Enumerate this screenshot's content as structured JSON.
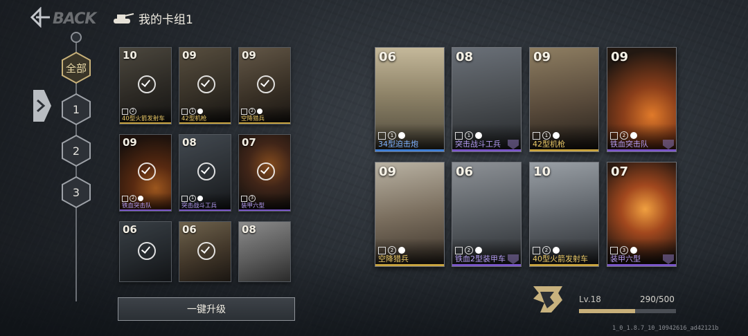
{
  "header": {
    "back_label": "BACK",
    "deck_title": "我的卡组1"
  },
  "deck_tabs": [
    {
      "label": "全部",
      "active": true
    },
    {
      "label": "1",
      "active": false
    },
    {
      "label": "2",
      "active": false
    },
    {
      "label": "3",
      "active": false
    }
  ],
  "deck_cards": [
    {
      "cost": "10",
      "name": "40型火箭发射车",
      "rarity": "gold",
      "stat_icon": "rocket-icon",
      "stat_value": "2",
      "selected": true,
      "flag": false
    },
    {
      "cost": "09",
      "name": "42型机枪",
      "rarity": "gold",
      "stat_icon": "mg-icon",
      "stat_value": "1",
      "selected": true,
      "flag": true
    },
    {
      "cost": "09",
      "name": "空降猎兵",
      "rarity": "gold",
      "stat_icon": "para-icon",
      "stat_value": "2",
      "selected": true,
      "flag": true
    },
    {
      "cost": "09",
      "name": "铁血突击队",
      "rarity": "purple",
      "stat_icon": "assault-icon",
      "stat_value": "2",
      "selected": true,
      "flag": true
    },
    {
      "cost": "08",
      "name": "突击战斗工兵",
      "rarity": "purple",
      "stat_icon": "engineer-icon",
      "stat_value": "1",
      "selected": true,
      "flag": true
    },
    {
      "cost": "07",
      "name": "装甲六型",
      "rarity": "purple",
      "stat_icon": "tank-icon",
      "stat_value": "3",
      "selected": true,
      "flag": false
    },
    {
      "cost": "06",
      "name": "",
      "rarity": "none",
      "stat_icon": "",
      "stat_value": "",
      "selected": true,
      "flag": false
    },
    {
      "cost": "06",
      "name": "",
      "rarity": "none",
      "stat_icon": "",
      "stat_value": "",
      "selected": true,
      "flag": false
    },
    {
      "cost": "08",
      "name": "",
      "rarity": "none",
      "stat_icon": "",
      "stat_value": "",
      "selected": false,
      "flag": false
    }
  ],
  "collection_cards": [
    {
      "cost": "06",
      "name": "34型迫击炮",
      "rarity": "blue",
      "stat_icon": "mortar-icon",
      "stat_value": "1"
    },
    {
      "cost": "08",
      "name": "突击战斗工兵",
      "rarity": "purple",
      "stat_icon": "engineer-icon",
      "stat_value": "1"
    },
    {
      "cost": "09",
      "name": "42型机枪",
      "rarity": "gold",
      "stat_icon": "mg-icon",
      "stat_value": "1"
    },
    {
      "cost": "09",
      "name": "铁血突击队",
      "rarity": "purple",
      "stat_icon": "assault-icon",
      "stat_value": "2"
    },
    {
      "cost": "09",
      "name": "空降猎兵",
      "rarity": "gold",
      "stat_icon": "para-icon",
      "stat_value": "2"
    },
    {
      "cost": "06",
      "name": "铁血2型装甲车",
      "rarity": "purple",
      "stat_icon": "armored-car-icon",
      "stat_value": "2"
    },
    {
      "cost": "10",
      "name": "40型火箭发射车",
      "rarity": "gold",
      "stat_icon": "rocket-icon",
      "stat_value": "2"
    },
    {
      "cost": "07",
      "name": "装甲六型",
      "rarity": "purple",
      "stat_icon": "tank-icon",
      "stat_value": "3"
    }
  ],
  "upgrade_button": "一键升级",
  "player_level": {
    "label": "Lv.18",
    "xp_text": "290/500",
    "progress_percent": 58
  },
  "build_id": "1_0_1.8.7_10_10942616_ad42121b",
  "colors": {
    "gold": "#c9a43f",
    "blue": "#3f7fd6",
    "purple": "#7a56c9"
  }
}
